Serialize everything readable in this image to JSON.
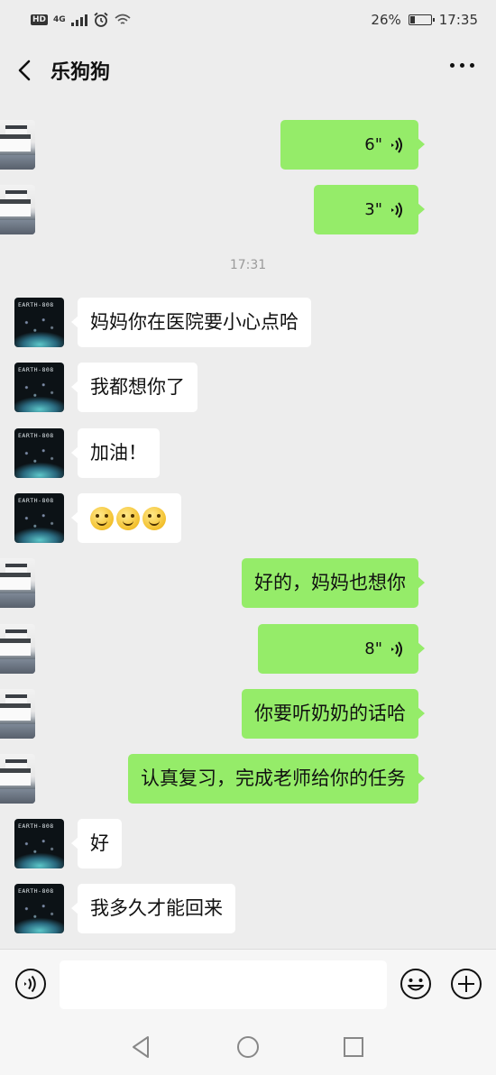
{
  "status_bar": {
    "hd": "HD",
    "network": "4G",
    "battery_percent": "26%",
    "battery_level": 0.26,
    "time": "17:35"
  },
  "header": {
    "title": "乐狗狗"
  },
  "avatars": {
    "other_label": "EARTH-808"
  },
  "chat": {
    "timestamp": "17:31",
    "messages": [
      {
        "side": "me",
        "type": "voice",
        "text": "6\""
      },
      {
        "side": "me",
        "type": "voice",
        "text": "3\""
      },
      {
        "side": "them",
        "type": "text",
        "text": "妈妈你在医院要小心点哈"
      },
      {
        "side": "them",
        "type": "text",
        "text": "我都想你了"
      },
      {
        "side": "them",
        "type": "text",
        "text": "加油！"
      },
      {
        "side": "them",
        "type": "emoji",
        "count": 3
      },
      {
        "side": "me",
        "type": "text",
        "text": "好的，妈妈也想你"
      },
      {
        "side": "me",
        "type": "voice",
        "text": "8\""
      },
      {
        "side": "me",
        "type": "text",
        "text": "你要听奶奶的话哈"
      },
      {
        "side": "me",
        "type": "text",
        "text": "认真复习，完成老师给你的任务"
      },
      {
        "side": "them",
        "type": "text",
        "text": "好"
      },
      {
        "side": "them",
        "type": "text",
        "text": "我多久才能回来"
      }
    ]
  },
  "input": {
    "value": "",
    "placeholder": ""
  },
  "colors": {
    "me_bubble": "#95ec69",
    "them_bubble": "#ffffff",
    "background": "#ededed"
  }
}
